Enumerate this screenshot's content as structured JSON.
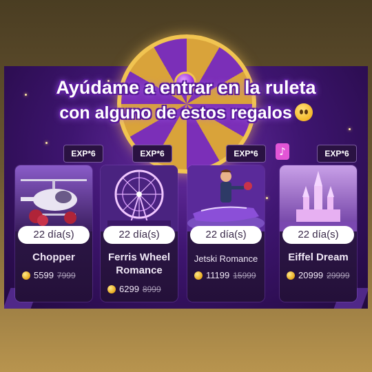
{
  "headline": {
    "line1": "Ayúdame a entrar en la ruleta",
    "line2": "con alguno de estos regalos"
  },
  "icons": [
    "pleading-face-emoji-icon",
    "music-note-icon",
    "coin-icon"
  ],
  "colors": {
    "panel_bg": "#3e1570",
    "accent_gold": "#f1c451",
    "badge_bg": "#2a1242",
    "note_icon": "#e255d6"
  },
  "gifts": [
    {
      "badge": "EXP*6",
      "days": "22 día(s)",
      "name": "Chopper",
      "price": "5599",
      "old_price": "7999"
    },
    {
      "badge": "EXP*6",
      "days": "22 día(s)",
      "name": "Ferris Wheel Romance",
      "price": "6299",
      "old_price": "8999"
    },
    {
      "badge": "EXP*6",
      "days": "22 día(s)",
      "name": "Jetski Romance",
      "price": "11199",
      "old_price": "15999"
    },
    {
      "badge": "EXP*6",
      "days": "22 día(s)",
      "name": "Eiffel Dream",
      "price": "20999",
      "old_price": "29999"
    }
  ]
}
